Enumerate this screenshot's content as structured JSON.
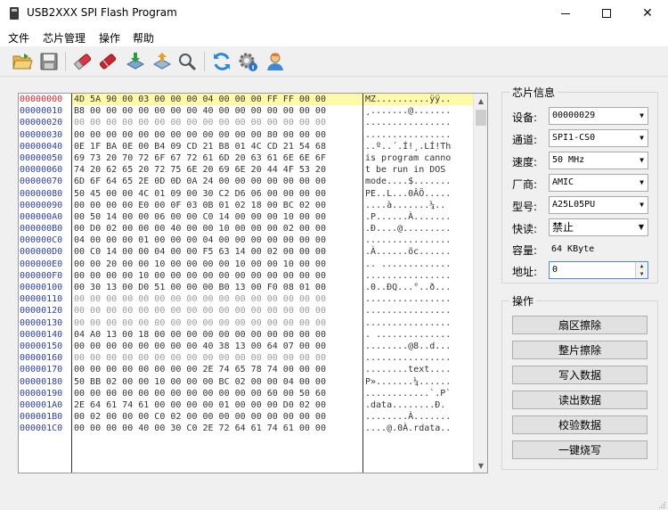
{
  "window": {
    "title": "USB2XXX SPI Flash Program",
    "controls": {
      "minimize_icon": "minimize-icon",
      "maximize_icon": "maximize-icon",
      "close_glyph": "✕"
    }
  },
  "menu": [
    "文件",
    "芯片管理",
    "操作",
    "帮助"
  ],
  "toolbar": {
    "buttons": [
      "open-folder-icon",
      "save-disk-icon",
      "erase-sector-icon",
      "erase-chip-icon",
      "write-data-icon",
      "read-data-icon",
      "verify-icon",
      "refresh-icon",
      "settings-info-icon",
      "user-icon"
    ]
  },
  "hex": {
    "addresses": [
      "00000000",
      "00000010",
      "00000020",
      "00000030",
      "00000040",
      "00000050",
      "00000060",
      "00000070",
      "00000080",
      "00000090",
      "000000A0",
      "000000B0",
      "000000C0",
      "000000D0",
      "000000E0",
      "000000F0",
      "00000100",
      "00000110",
      "00000120",
      "00000130",
      "00000140",
      "00000150",
      "00000160",
      "00000170",
      "00000180",
      "00000190",
      "000001A0",
      "000001B0",
      "000001C0"
    ],
    "bytes": [
      "4D 5A 90 00 03 00 00 00 04 00 00 00 FF FF 00 00",
      "B8 00 00 00 00 00 00 00 40 00 00 00 00 00 00 00",
      "00 00 00 00 00 00 00 00 00 00 00 00 00 00 00 00",
      "00 00 00 00 00 00 00 00 00 00 00 00 80 00 00 00",
      "0E 1F BA 0E 00 B4 09 CD 21 B8 01 4C CD 21 54 68",
      "69 73 20 70 72 6F 67 72 61 6D 20 63 61 6E 6E 6F",
      "74 20 62 65 20 72 75 6E 20 69 6E 20 44 4F 53 20",
      "6D 6F 64 65 2E 0D 0D 0A 24 00 00 00 00 00 00 00",
      "50 45 00 00 4C 01 09 00 30 C2 D6 06 00 00 00 00",
      "00 00 00 00 E0 00 0F 03 0B 01 02 18 00 BC 02 00",
      "00 50 14 00 00 06 00 00 C0 14 00 00 00 10 00 00",
      "00 D0 02 00 00 00 40 00 00 10 00 00 00 02 00 00",
      "04 00 00 00 01 00 00 00 04 00 00 00 00 00 00 00",
      "00 C0 14 00 00 04 00 00 F5 63 14 00 02 00 00 00",
      "00 00 20 00 00 10 00 00 00 00 10 00 00 10 00 00",
      "00 00 00 00 10 00 00 00 00 00 00 00 00 00 00 00",
      "00 30 13 00 D0 51 00 00 00 B0 13 00 F0 08 01 00",
      "00 00 00 00 00 00 00 00 00 00 00 00 00 00 00 00",
      "00 00 00 00 00 00 00 00 00 00 00 00 00 00 00 00",
      "00 00 00 00 00 00 00 00 00 00 00 00 00 00 00 00",
      "04 A0 13 00 18 00 00 00 00 00 00 00 00 00 00 00",
      "00 00 00 00 00 00 00 00 40 38 13 00 64 07 00 00",
      "00 00 00 00 00 00 00 00 00 00 00 00 00 00 00 00",
      "00 00 00 00 00 00 00 00 2E 74 65 78 74 00 00 00",
      "50 BB 02 00 00 10 00 00 00 BC 02 00 00 04 00 00",
      "00 00 00 00 00 00 00 00 00 00 00 00 60 00 50 60",
      "2E 64 61 74 61 00 00 00 00 01 00 00 00 D0 02 00",
      "00 02 00 00 00 C0 02 00 00 00 00 00 00 00 00 00",
      "00 00 00 00 40 00 30 C0 2E 72 64 61 74 61 00 00"
    ],
    "ascii": [
      "MZ..........ÿÿ..",
      "¸.......@.......",
      "................",
      "................",
      "..º..´.Í!¸.LÍ!Th",
      "is program canno",
      "t be run in DOS ",
      "mode....$.......",
      "PE..L...0ÂÖ.....",
      "....à.......¼..",
      ".P......À.......",
      ".Ð....@.........",
      "................",
      ".À......õc......",
      ".. .............",
      "................",
      ".0..ÐQ...°..ð...",
      "................",
      "................",
      "................",
      ". ..............",
      "........@8..d...",
      "................",
      "........text....",
      "P».......¼......",
      "............`.P`",
      ".data........Ð.",
      "........À.......",
      "....@.0À.rdata.."
    ]
  },
  "chip_info": {
    "title": "芯片信息",
    "fields": [
      {
        "label": "设备:",
        "value": "00000029"
      },
      {
        "label": "通道:",
        "value": "SPI1-CS0"
      },
      {
        "label": "速度:",
        "value": "50 MHz"
      },
      {
        "label": "厂商:",
        "value": "AMIC"
      },
      {
        "label": "型号:",
        "value": "A25L05PU"
      },
      {
        "label": "快读:",
        "value": "禁止"
      }
    ],
    "capacity": {
      "label": "容量:",
      "value": "64 KByte"
    },
    "address": {
      "label": "地址:",
      "value": "0"
    }
  },
  "operations": {
    "title": "操作",
    "buttons": [
      "扇区擦除",
      "整片擦除",
      "写入数据",
      "读出数据",
      "校验数据",
      "一键烧写"
    ]
  },
  "colors": {
    "address": "#2b3ea8",
    "selected_address": "#e0202a",
    "highlight_row": "#fdfba8"
  }
}
